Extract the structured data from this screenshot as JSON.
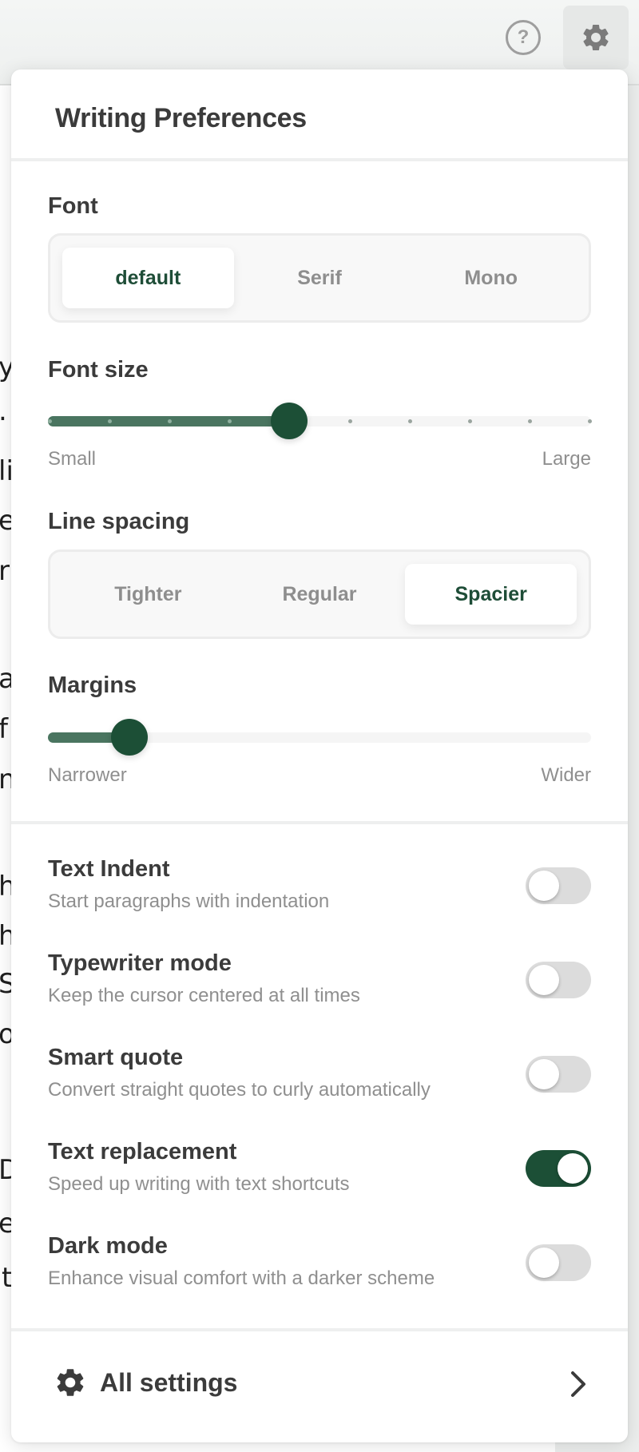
{
  "toolbar": {
    "help_icon": "question-circle-icon",
    "settings_icon": "gear-icon",
    "help_glyph": "?"
  },
  "document": {
    "visible_fragments": [
      {
        "text": "y"
      },
      {
        "text": ". "
      },
      {
        "text": "li"
      },
      {
        "text": "eg"
      },
      {
        "text": "r"
      },
      {
        "text": "a"
      },
      {
        "text": "f"
      },
      {
        "text": "ng"
      },
      {
        "text": "he"
      },
      {
        "text": "he"
      },
      {
        "text": "S"
      },
      {
        "text": "ou"
      },
      {
        "text": "D"
      },
      {
        "text": "e!"
      },
      {
        "text": "t get out.' Only I don't think,"
      }
    ]
  },
  "panel": {
    "title": "Writing Preferences",
    "font": {
      "label": "Font",
      "options": [
        "default",
        "Serif",
        "Mono"
      ],
      "selected": "default"
    },
    "font_size": {
      "label": "Font size",
      "min_label": "Small",
      "max_label": "Large",
      "steps": 10,
      "value_index": 4
    },
    "line_spacing": {
      "label": "Line spacing",
      "options": [
        "Tighter",
        "Regular",
        "Spacier"
      ],
      "selected": "Spacier"
    },
    "margins": {
      "label": "Margins",
      "min_label": "Narrower",
      "max_label": "Wider",
      "value_fraction": 0.15
    },
    "toggles": [
      {
        "title": "Text Indent",
        "description": "Start paragraphs with indentation",
        "on": false
      },
      {
        "title": "Typewriter mode",
        "description": "Keep the cursor centered at all times",
        "on": false
      },
      {
        "title": "Smart quote",
        "description": "Convert straight quotes to curly automatically",
        "on": false
      },
      {
        "title": "Text replacement",
        "description": "Speed up writing with text shortcuts",
        "on": true
      },
      {
        "title": "Dark mode",
        "description": "Enhance visual comfort with a darker scheme",
        "on": false
      }
    ],
    "all_settings": {
      "label": "All settings",
      "icon": "gear-icon",
      "chevron": "chevron-right-icon"
    }
  },
  "colors": {
    "accent": "#1c4f36",
    "accent_fill": "#4a7560",
    "muted_text": "#8f8f8f",
    "heading_text": "#3b3b3b"
  }
}
